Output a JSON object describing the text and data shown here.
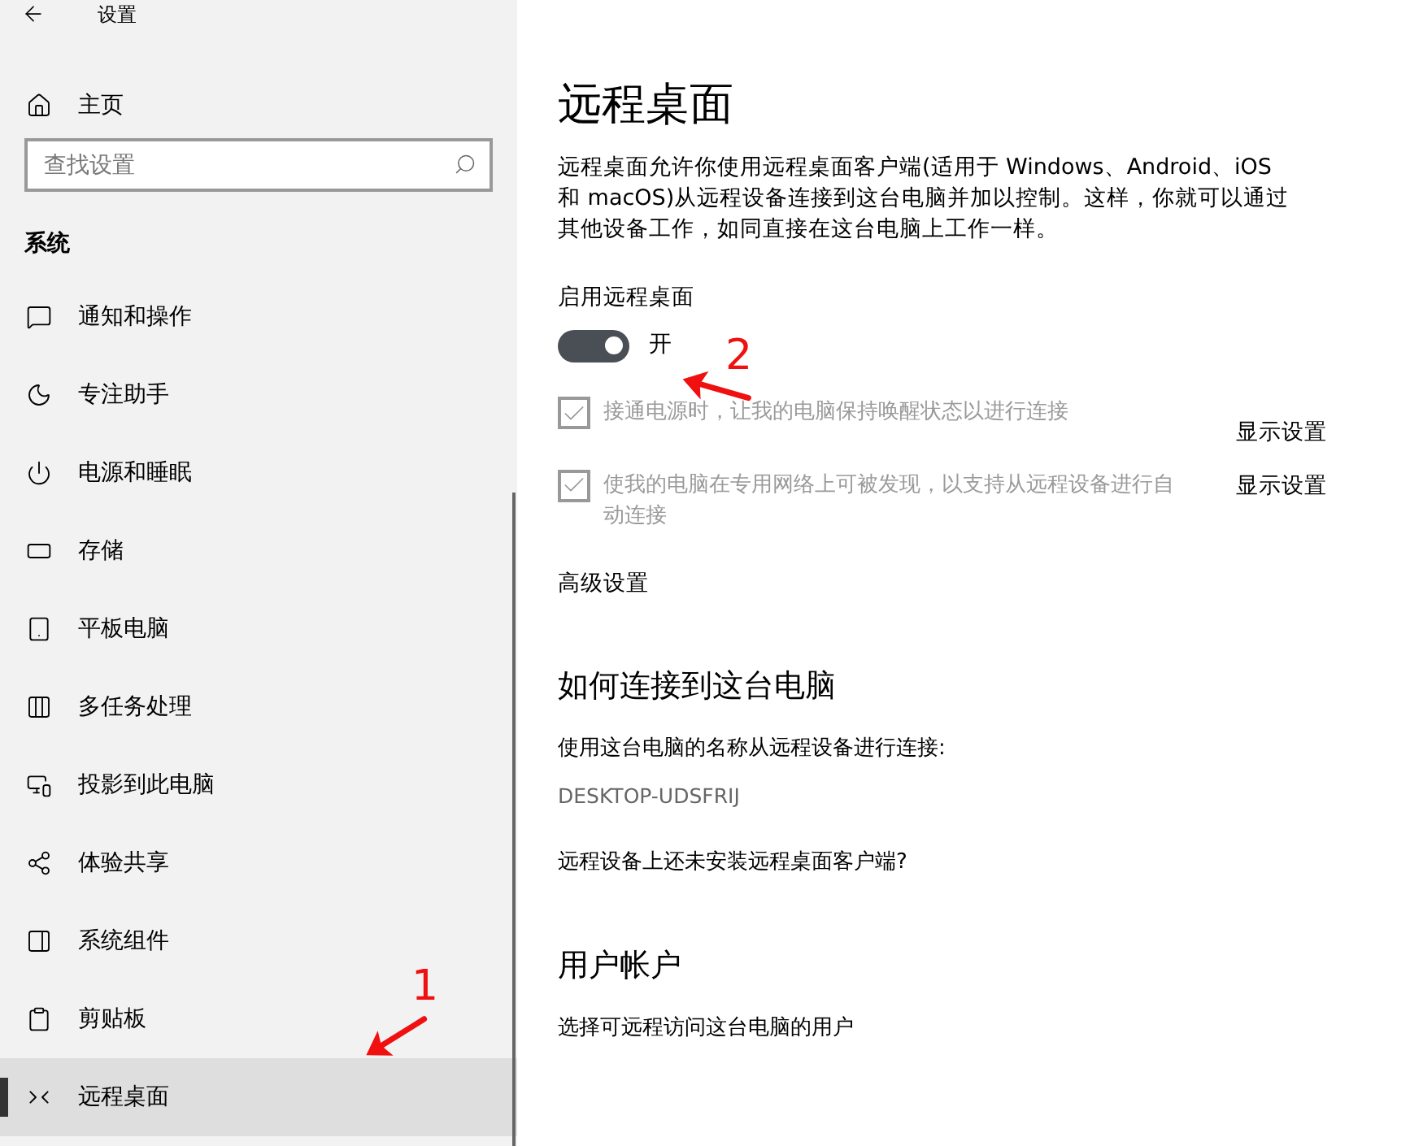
{
  "window": {
    "title": "设置"
  },
  "sidebar": {
    "home": "主页",
    "search": {
      "placeholder": "查找设置"
    },
    "section": "系统",
    "items": [
      {
        "label": "通知和操作",
        "selected": false
      },
      {
        "label": "专注助手",
        "selected": false
      },
      {
        "label": "电源和睡眠",
        "selected": false
      },
      {
        "label": "存储",
        "selected": false
      },
      {
        "label": "平板电脑",
        "selected": false
      },
      {
        "label": "多任务处理",
        "selected": false
      },
      {
        "label": "投影到此电脑",
        "selected": false
      },
      {
        "label": "体验共享",
        "selected": false
      },
      {
        "label": "系统组件",
        "selected": false
      },
      {
        "label": "剪贴板",
        "selected": false
      },
      {
        "label": "远程桌面",
        "selected": true
      }
    ]
  },
  "page": {
    "title": "远程桌面",
    "description": "远程桌面允许你使用远程桌面客户端(适用于 Windows、Android、iOS 和 macOS)从远程设备连接到这台电脑并加以控制。这样，你就可以通过其他设备工作，如同直接在这台电脑上工作一样。",
    "enable_label": "启用远程桌面",
    "toggle": {
      "on": true,
      "label": "开"
    },
    "options": [
      {
        "label": "接通电源时，让我的电脑保持唤醒状态以进行连接",
        "checked": true,
        "disabled": true,
        "link": "显示设置"
      },
      {
        "label": "使我的电脑在专用网络上可被发现，以支持从远程设备进行自动连接",
        "checked": true,
        "disabled": true,
        "link": "显示设置"
      }
    ],
    "advanced_link": "高级设置",
    "sections": [
      {
        "heading": "如何连接到这台电脑",
        "texts": [
          {
            "kind": "text",
            "text": "使用这台电脑的名称从远程设备进行连接:"
          },
          {
            "kind": "value",
            "text": "DESKTOP-UDSFRIJ"
          },
          {
            "kind": "link",
            "text": "远程设备上还未安装远程桌面客户端?"
          }
        ]
      },
      {
        "heading": "用户帐户",
        "texts": [
          {
            "kind": "link",
            "text": "选择可远程访问这台电脑的用户"
          }
        ]
      }
    ]
  },
  "annotations": [
    "1",
    "2"
  ]
}
